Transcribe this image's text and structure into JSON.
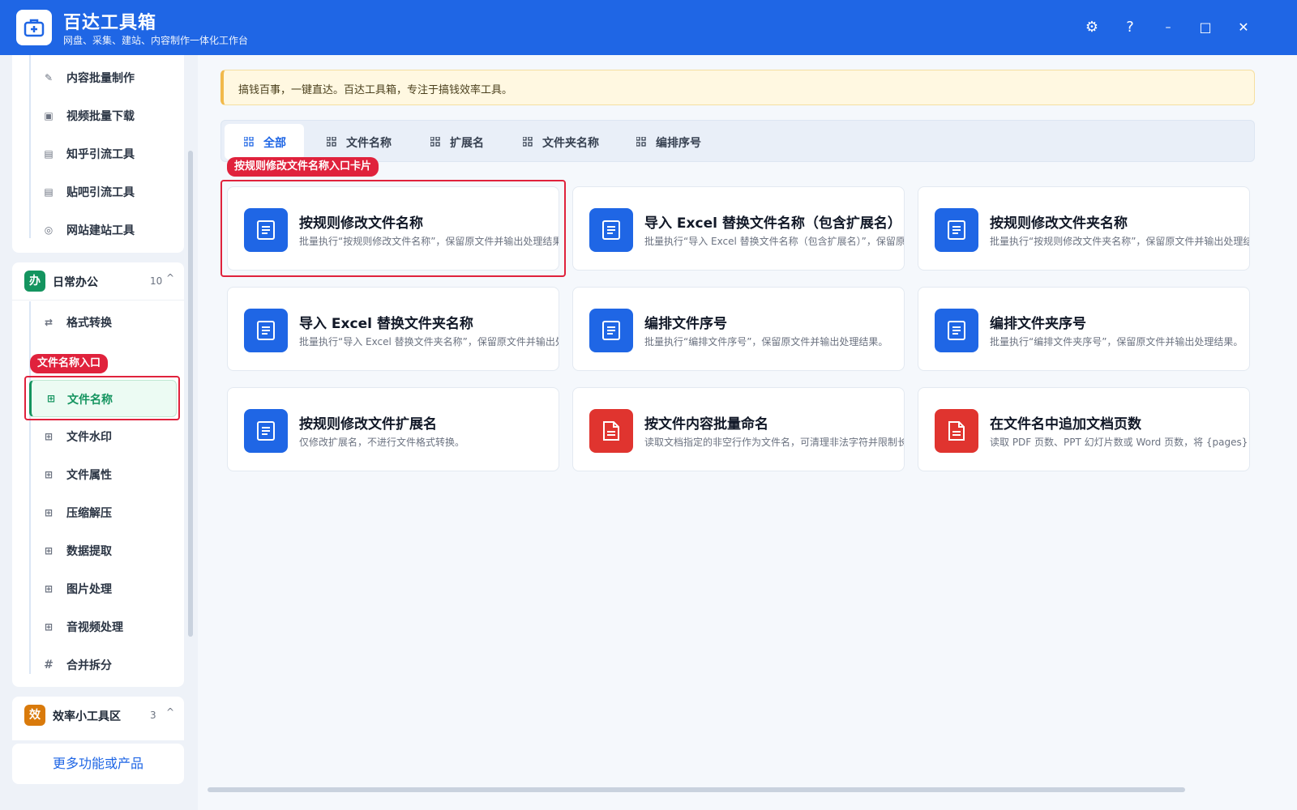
{
  "app": {
    "title": "百达工具箱",
    "subtitle": "网盘、采集、建站、内容制作一体化工作台"
  },
  "window_controls": {
    "settings": "⚙",
    "help": "?",
    "minimize": "–",
    "maximize": "□",
    "close": "✕"
  },
  "sidebar": {
    "top_items": [
      {
        "label": "内容批量制作",
        "icon": "✎"
      },
      {
        "label": "视频批量下载",
        "icon": "▣"
      },
      {
        "label": "知乎引流工具",
        "icon": "▤"
      },
      {
        "label": "贴吧引流工具",
        "icon": "▤"
      },
      {
        "label": "网站建站工具",
        "icon": "◎"
      }
    ],
    "group_office": {
      "badge": "办",
      "badge_color": "#14945f",
      "title": "日常办公",
      "count": "10",
      "caret": "^",
      "items": [
        {
          "label": "格式转换",
          "icon": "⇄"
        },
        {
          "label": "文件名称",
          "icon": "⊞"
        },
        {
          "label": "文件水印",
          "icon": "⊞"
        },
        {
          "label": "文件属性",
          "icon": "⊞"
        },
        {
          "label": "压缩解压",
          "icon": "⊞"
        },
        {
          "label": "数据提取",
          "icon": "⊞"
        },
        {
          "label": "图片处理",
          "icon": "⊞"
        },
        {
          "label": "音视频处理",
          "icon": "⊞"
        },
        {
          "label": "合并拆分",
          "icon": "#"
        }
      ]
    },
    "group_efficiency": {
      "badge": "效",
      "badge_color": "#d97a0b",
      "title": "效率小工具区",
      "count": "3",
      "caret": "^"
    },
    "more_button": "更多功能或产品",
    "callout": "文件名称入口"
  },
  "main": {
    "notice": "搞钱百事，一键直达。百达工具箱，专注于搞钱效率工具。",
    "tabs": [
      "全部",
      "文件名称",
      "扩展名",
      "文件夹名称",
      "编排序号"
    ],
    "card_callout": "按规则修改文件名称入口卡片",
    "cards": [
      {
        "title": "按规则修改文件名称",
        "desc": "批量执行“按规则修改文件名称”，保留原文件并输出处理结果。",
        "color": "#1f66e5"
      },
      {
        "title": "导入 Excel 替换文件名称（包含扩展名）",
        "desc": "批量执行“导入 Excel 替换文件名称（包含扩展名）”，保留原文件",
        "color": "#1f66e5"
      },
      {
        "title": "按规则修改文件夹名称",
        "desc": "批量执行“按规则修改文件夹名称”，保留原文件并输出处理结果。",
        "color": "#1f66e5"
      },
      {
        "title": "导入 Excel 替换文件夹名称",
        "desc": "批量执行“导入 Excel 替换文件夹名称”，保留原文件并输出处理结",
        "color": "#1f66e5"
      },
      {
        "title": "编排文件序号",
        "desc": "批量执行“编排文件序号”，保留原文件并输出处理结果。",
        "color": "#1f66e5"
      },
      {
        "title": "编排文件夹序号",
        "desc": "批量执行“编排文件夹序号”，保留原文件并输出处理结果。",
        "color": "#1f66e5"
      },
      {
        "title": "按规则修改文件扩展名",
        "desc": "仅修改扩展名，不进行文件格式转换。",
        "color": "#1f66e5"
      },
      {
        "title": "按文件内容批量命名",
        "desc": "读取文档指定的非空行作为文件名，可清理非法字符并限制长度；",
        "color": "#e0342f"
      },
      {
        "title": "在文件名中追加文档页数",
        "desc": "读取 PDF 页数、PPT 幻灯片数或 Word 页数，将 {pages} 写入命名",
        "color": "#e0342f"
      }
    ]
  }
}
